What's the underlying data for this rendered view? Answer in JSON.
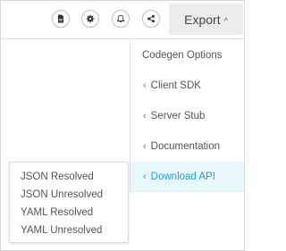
{
  "toolbar": {
    "icons": [
      {
        "name": "document-icon"
      },
      {
        "name": "settings-icon"
      },
      {
        "name": "bell-icon"
      },
      {
        "name": "share-icon"
      }
    ],
    "export_label": "Export",
    "export_caret": "^"
  },
  "menu": {
    "header": "Codegen Options",
    "items": [
      {
        "label": "Client SDK",
        "chevron": "‹"
      },
      {
        "label": "Server Stub",
        "chevron": "‹"
      },
      {
        "label": "Documentation",
        "chevron": "‹"
      },
      {
        "label": "Download API",
        "chevron": "‹",
        "active": true
      }
    ]
  },
  "submenu": {
    "items": [
      {
        "label": "JSON Resolved"
      },
      {
        "label": "JSON Unresolved"
      },
      {
        "label": "YAML Resolved"
      },
      {
        "label": "YAML Unresolved"
      }
    ]
  },
  "colors": {
    "active_bg": "#e8f7fc",
    "active_text": "#2a9fd6",
    "export_bg": "#ececec"
  }
}
